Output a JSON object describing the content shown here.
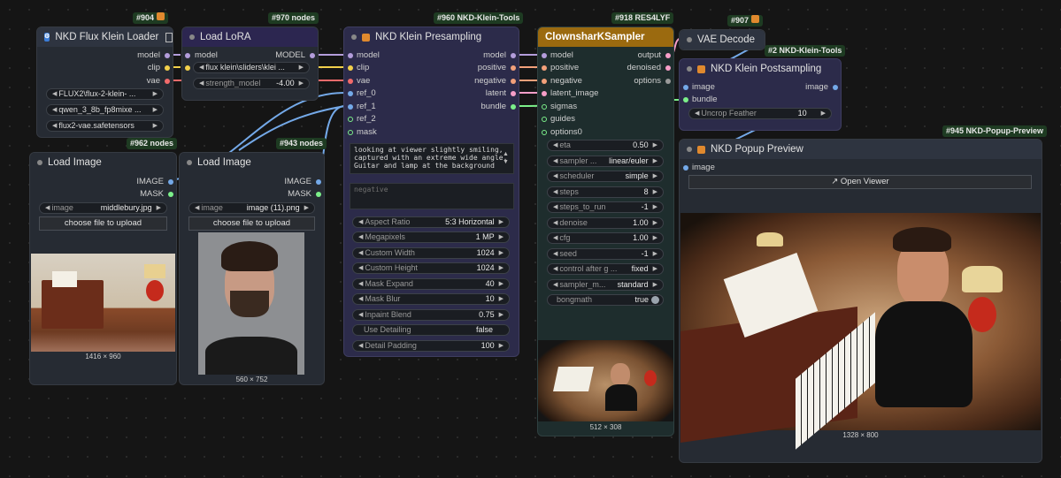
{
  "tags": {
    "t904": "#904",
    "t970": "#970 nodes",
    "t960": "#960 NKD-Klein-Tools",
    "t918": "#918 RES4LYF",
    "t907": "#907",
    "t2": "#2 NKD-Klein-Tools",
    "t962": "#962 nodes",
    "t943": "#943 nodes",
    "t945": "#945 NKD-Popup-Preview"
  },
  "loader": {
    "title": "NKD Flux Klein Loader",
    "outputs": [
      "model",
      "clip",
      "vae"
    ],
    "widgets": [
      "FLUX2\\flux-2-klein- ...",
      "qwen_3_8b_fp8mixe ...",
      "flux2-vae.safetensors"
    ]
  },
  "lora": {
    "title": "Load LoRA",
    "in_model": "model",
    "in_clip": "clip",
    "out_model": "MODEL",
    "lora_name": "flux klein\\sliders\\klei ...",
    "strength_label": "strength_model",
    "strength_value": "-4.00"
  },
  "img1": {
    "title": "Load Image",
    "out_image": "IMAGE",
    "out_mask": "MASK",
    "label": "image",
    "value": "middlebury.jpg",
    "upload": "choose file to upload",
    "size": "1416 × 960"
  },
  "img2": {
    "title": "Load Image",
    "out_image": "IMAGE",
    "out_mask": "MASK",
    "label": "image",
    "value": "image (11).png",
    "upload": "choose file to upload",
    "size": "560 × 752"
  },
  "pre": {
    "title": "NKD Klein Presampling",
    "inputs": [
      "model",
      "clip",
      "vae",
      "ref_0",
      "ref_1",
      "ref_2",
      "mask"
    ],
    "outputs": [
      "model",
      "positive",
      "negative",
      "latent",
      "bundle"
    ],
    "prompt": "looking at viewer slightly smiling,\ncaptured with an extreme wide angle.\nGuitar and lamp at the background",
    "negative": "negative",
    "widgets": [
      {
        "l": "Aspect Ratio",
        "v": "5:3 Horizontal"
      },
      {
        "l": "Megapixels",
        "v": "1 MP"
      },
      {
        "l": "Custom Width",
        "v": "1024"
      },
      {
        "l": "Custom Height",
        "v": "1024"
      },
      {
        "l": "Mask Expand",
        "v": "40"
      },
      {
        "l": "Mask Blur",
        "v": "10"
      },
      {
        "l": "Inpaint Blend",
        "v": "0.75"
      },
      {
        "l": "Use Detailing",
        "v": "false"
      },
      {
        "l": "Detail Padding",
        "v": "100"
      }
    ]
  },
  "ks": {
    "title": "ClownsharKSampler",
    "inputs": [
      "model",
      "positive",
      "negative",
      "latent_image",
      "sigmas",
      "guides",
      "options0"
    ],
    "outputs": [
      "output",
      "denoised",
      "options"
    ],
    "widgets": [
      {
        "l": "eta",
        "v": "0.50"
      },
      {
        "l": "sampler ...",
        "v": "linear/euler"
      },
      {
        "l": "scheduler",
        "v": "simple"
      },
      {
        "l": "steps",
        "v": "8"
      },
      {
        "l": "steps_to_run",
        "v": "-1"
      },
      {
        "l": "denoise",
        "v": "1.00"
      },
      {
        "l": "cfg",
        "v": "1.00"
      },
      {
        "l": "seed",
        "v": "-1"
      },
      {
        "l": "control after g ...",
        "v": "fixed"
      },
      {
        "l": "sampler_m...",
        "v": "standard"
      }
    ],
    "toggle_label": "bongmath",
    "toggle_value": "true",
    "size": "512 × 308"
  },
  "vae": {
    "title": "VAE Decode"
  },
  "post": {
    "title": "NKD Klein Postsampling",
    "in_image": "image",
    "in_bundle": "bundle",
    "out_image": "image",
    "w_label": "Uncrop Feather",
    "w_value": "10"
  },
  "popup": {
    "title": "NKD Popup Preview",
    "in_image": "image",
    "button": "↗ Open Viewer",
    "size": "1328 × 800"
  },
  "colors": {
    "model": "#b39ddb",
    "clip": "#f2d04b",
    "vae": "#f26b6b",
    "image": "#74a9e8",
    "cond": "#f2a07a",
    "latent": "#f79ec8",
    "bundle": "#7cf08a",
    "ks_title": "#9b6a0f"
  }
}
